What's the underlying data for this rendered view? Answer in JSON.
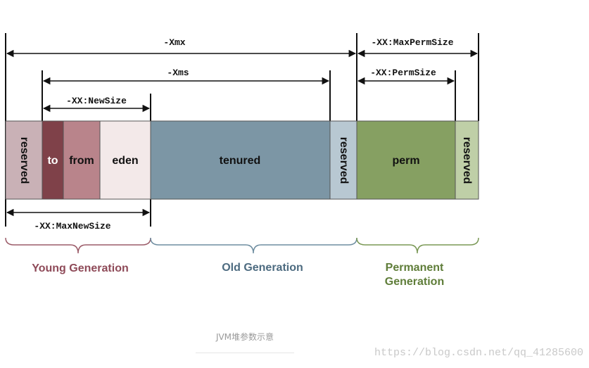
{
  "dimensions": {
    "xmx": "-Xmx",
    "xms": "-Xms",
    "new_size": "-XX:NewSize",
    "max_new_size": "-XX:MaxNewSize",
    "max_perm_size": "-XX:MaxPermSize",
    "perm_size": "-XX:PermSize"
  },
  "segments": {
    "reserved_young": "reserved",
    "to": "to",
    "from": "from",
    "eden": "eden",
    "tenured": "tenured",
    "reserved_old": "reserved",
    "perm": "perm",
    "reserved_perm": "reserved"
  },
  "generations": {
    "young": "Young Generation",
    "old": "Old Generation",
    "permanent_line1": "Permanent",
    "permanent_line2": "Generation"
  },
  "caption": "JVM堆参数示意",
  "watermark": "https://blog.csdn.net/qq_41285600",
  "colors": {
    "reserved_young": "#c9b1b6",
    "to": "#7f4149",
    "from": "#b9848b",
    "eden": "#f3e9e9",
    "tenured": "#7c96a5",
    "reserved_old": "#b8c8d2",
    "perm": "#86a062",
    "reserved_perm": "#bfcfa7",
    "young_text": "#8e4a58",
    "old_text": "#4d6b80",
    "perm_text": "#5f7d39",
    "young_brace": "#9b5b68",
    "old_brace": "#6e8da0",
    "perm_brace": "#7a9855"
  }
}
